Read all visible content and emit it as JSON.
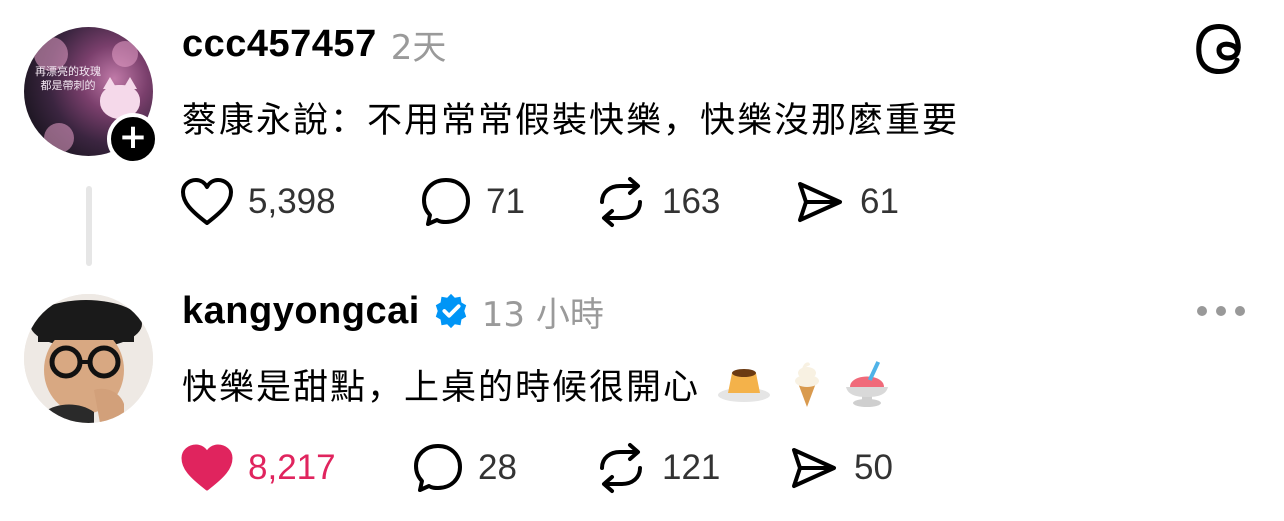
{
  "post1": {
    "username": "ccc457457",
    "time": "2天",
    "text": "蔡康永說：不用常常假裝快樂，快樂沒那麼重要",
    "avatar_text_line1": "再漂亮的玫瑰",
    "avatar_text_line2": "都是帶刺的",
    "actions": {
      "likes": "5,398",
      "comments": "71",
      "reposts": "163",
      "shares": "61"
    }
  },
  "post2": {
    "username": "kangyongcai",
    "time": "13 小時",
    "text": "快樂是甜點，上桌的時候很開心",
    "emojis": [
      "pudding",
      "soft-ice-cream",
      "shaved-ice"
    ],
    "actions": {
      "likes": "8,217",
      "comments": "28",
      "reposts": "121",
      "shares": "50"
    }
  },
  "colors": {
    "liked": "#e0245e",
    "verified": "#0095f6",
    "muted": "#9a9a9a"
  }
}
